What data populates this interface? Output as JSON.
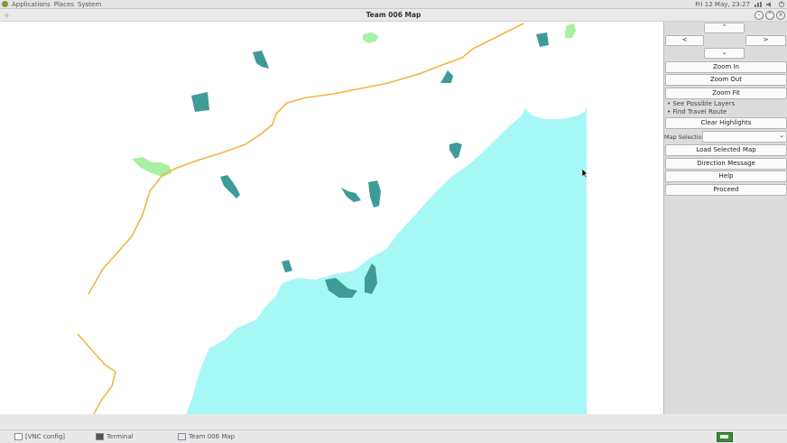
{
  "top_bar": {
    "menus": [
      "Applications",
      "Places",
      "System"
    ],
    "datetime": "Fri 12 May, 23:27"
  },
  "window": {
    "title": "Team 006 Map"
  },
  "colors": {
    "water": "#a6f8f6",
    "building": "#3e9b97",
    "park": "#a6f2a3",
    "road": "#f2b540",
    "land": "#ffffff"
  },
  "panel": {
    "nav": {
      "up_label": "⌃",
      "down_label": "⌄",
      "left_label": "<",
      "right_label": ">"
    },
    "zoom_in_label": "Zoom In",
    "zoom_out_label": "Zoom Out",
    "zoom_fit_label": "Zoom Fit",
    "see_layers_label": "• See Possible Layers",
    "find_route_label": "• Find Travel Route",
    "clear_highlights_label": "Clear Highlights",
    "map_selection_label": "Map Selection",
    "map_selection_value": "",
    "load_map_label": "Load Selected Map",
    "direction_message_label": "Direction Message",
    "help_label": "Help",
    "proceed_label": "Proceed"
  },
  "taskbar": {
    "items": [
      "[VNC config]",
      "Terminal",
      "Team 006 Map"
    ]
  }
}
